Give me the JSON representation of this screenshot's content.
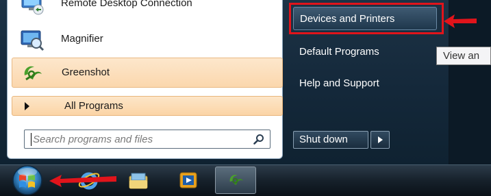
{
  "start_menu": {
    "programs": [
      {
        "label": "Remote Desktop Connection",
        "icon": "remote-desktop-icon"
      },
      {
        "label": "Magnifier",
        "icon": "magnifier-icon"
      },
      {
        "label": "Greenshot",
        "icon": "greenshot-icon"
      }
    ],
    "all_programs": "All Programs",
    "search_placeholder": "Search programs and files",
    "right_items": [
      "Devices and Printers",
      "Default Programs",
      "Help and Support"
    ],
    "shutdown_label": "Shut down",
    "tooltip": "View an"
  },
  "taskbar": {
    "icons": [
      "start-orb-icon",
      "internet-explorer-icon",
      "windows-explorer-icon",
      "media-player-icon",
      "greenshot-icon"
    ]
  },
  "colors": {
    "highlight": "#e1141b",
    "annotation_arrow": "#e1141b",
    "selected_item": "#fbd7ad"
  }
}
